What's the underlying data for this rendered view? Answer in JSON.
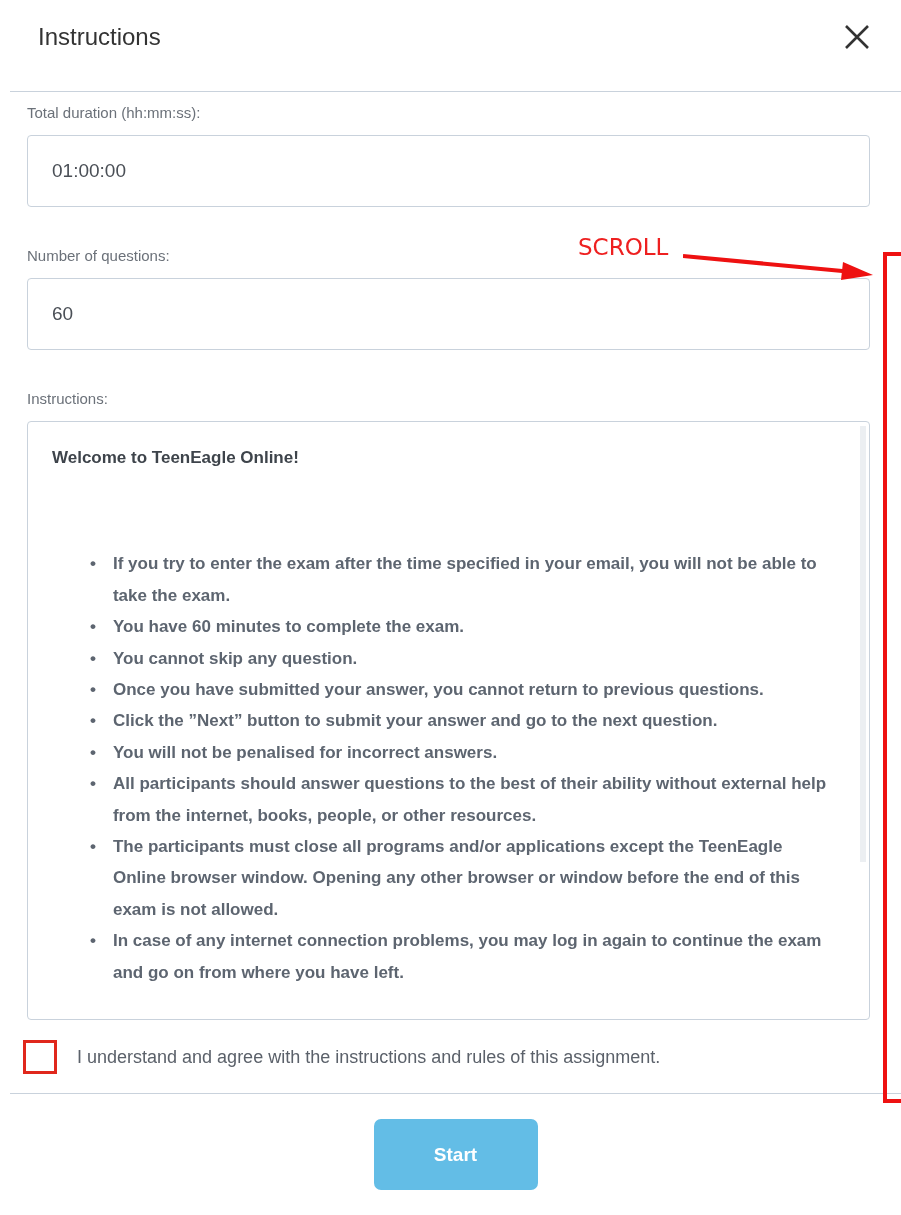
{
  "dialog": {
    "title": "Instructions"
  },
  "fields": [
    {
      "label": "Total duration (hh:mm:ss):",
      "value": "01:00:00"
    },
    {
      "label": "Number of questions:",
      "value": "60"
    }
  ],
  "instructions": {
    "label": "Instructions:",
    "heading": "Welcome to TeenEagle Online!",
    "items": [
      {
        "bullet": "•",
        "text": "If you try to enter the exam after the time specified in your email, you will not be able to take the exam."
      },
      {
        "bullet": "•",
        "text": "You have 60 minutes to complete the exam."
      },
      {
        "bullet": "•",
        "text": "You cannot skip any question."
      },
      {
        "bullet": "•",
        "text": "Once you have submitted your answer, you cannot return to previous questions."
      },
      {
        "bullet": "•",
        "text": "Click the ”Next” button to submit your answer and go to the next question."
      },
      {
        "bullet": "•",
        "text": "You will not be penalised for incorrect answers."
      },
      {
        "bullet": "•",
        "text": "All participants should answer questions to the best of their ability without external help from the internet, books, people, or other resources."
      },
      {
        "bullet": "•",
        "text": "The participants must close all programs and/or applications except the TeenEagle Online browser window. Opening any other browser or window before the end of this exam is not allowed."
      },
      {
        "bullet": "•",
        "text": "In case of any internet connection problems, you may log in again to continue the exam and go on from where you have left."
      }
    ]
  },
  "agreement": {
    "label": "I understand and agree with the instructions and rules of this assignment.",
    "checked": false
  },
  "start_button": {
    "label": "Start",
    "disabled": true
  },
  "annotation": {
    "text": "SCROLL"
  }
}
